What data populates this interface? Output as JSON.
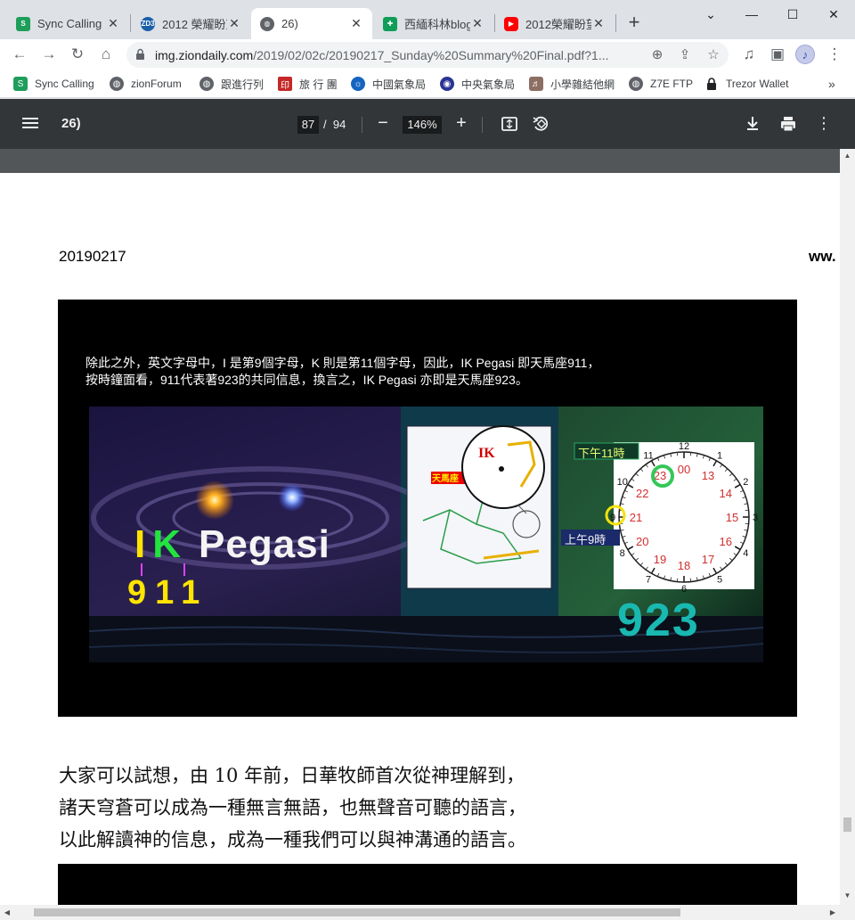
{
  "tabs": [
    {
      "title": "Sync Calling",
      "favicon": "sync-calling-favicon",
      "active": false
    },
    {
      "title": "2012 榮耀盼望",
      "favicon": "zd3-favicon",
      "active": false
    },
    {
      "title": "26)",
      "favicon": "globe-favicon",
      "active": true
    },
    {
      "title": "西緬科林blog",
      "favicon": "plus-favicon",
      "active": false
    },
    {
      "title": "2012榮耀盼望",
      "favicon": "youtube-favicon",
      "active": false
    }
  ],
  "toolbar": {
    "url_host": "img.ziondaily.com",
    "url_path": "/2019/02/02c/20190217_Sunday%20Summary%20Final.pdf?1..."
  },
  "bookmarks": [
    {
      "label": "Sync Calling",
      "icon": "sync-calling-favicon"
    },
    {
      "label": "zionForum",
      "icon": "globe-icon"
    },
    {
      "label": "跟進行列",
      "icon": "globe-icon"
    },
    {
      "label": "旅 行 團",
      "icon": "seal-favicon"
    },
    {
      "label": "中國氣象局",
      "icon": "weather-favicon"
    },
    {
      "label": "中央氣象局",
      "icon": "cwb-favicon"
    },
    {
      "label": "小學雜結他網",
      "icon": "guitar-favicon"
    },
    {
      "label": "Z7E FTP",
      "icon": "globe-icon"
    },
    {
      "label": "Trezor Wallet",
      "icon": "lock-icon"
    }
  ],
  "bookmarks_overflow": "»",
  "pdf": {
    "title": "26)",
    "page_current": "87",
    "page_separator": "/",
    "page_total": "94",
    "zoom": "146%"
  },
  "page": {
    "date": "20190217",
    "website_fragment": "ww.",
    "slide": {
      "caption_line1": "除此之外，英文字母中，I 是第9個字母，K 則是第11個字母，因此，IK Pegasi 即天馬座911，",
      "caption_line2": "按時鐘面看，911代表著923的共同信息，換言之，IK Pegasi 亦即是天馬座923。",
      "big_title_i": "I",
      "big_title_k": "K",
      "big_title_rest": "Pegasi",
      "big_number": "911",
      "chart_label": "天馬座",
      "ik_label": "IK",
      "pm_label": "下午11時",
      "am_label": "上午9時",
      "result_number": "923"
    },
    "body_lines": [
      "大家可以試想，由 10 年前，日華牧師首次從神理解到，",
      "諸天穹蒼可以成為一種無言無語，也無聲音可聽的語言，",
      "以此解讀神的信息，成為一種我們可以與神溝通的語言。"
    ]
  },
  "clock": {
    "outer": [
      "12",
      "1",
      "2",
      "3",
      "4",
      "5",
      "6",
      "7",
      "8",
      "9",
      "10",
      "11"
    ],
    "inner": [
      "00",
      "13",
      "14",
      "15",
      "16",
      "17",
      "18",
      "19",
      "20",
      "21",
      "22",
      "23"
    ]
  }
}
